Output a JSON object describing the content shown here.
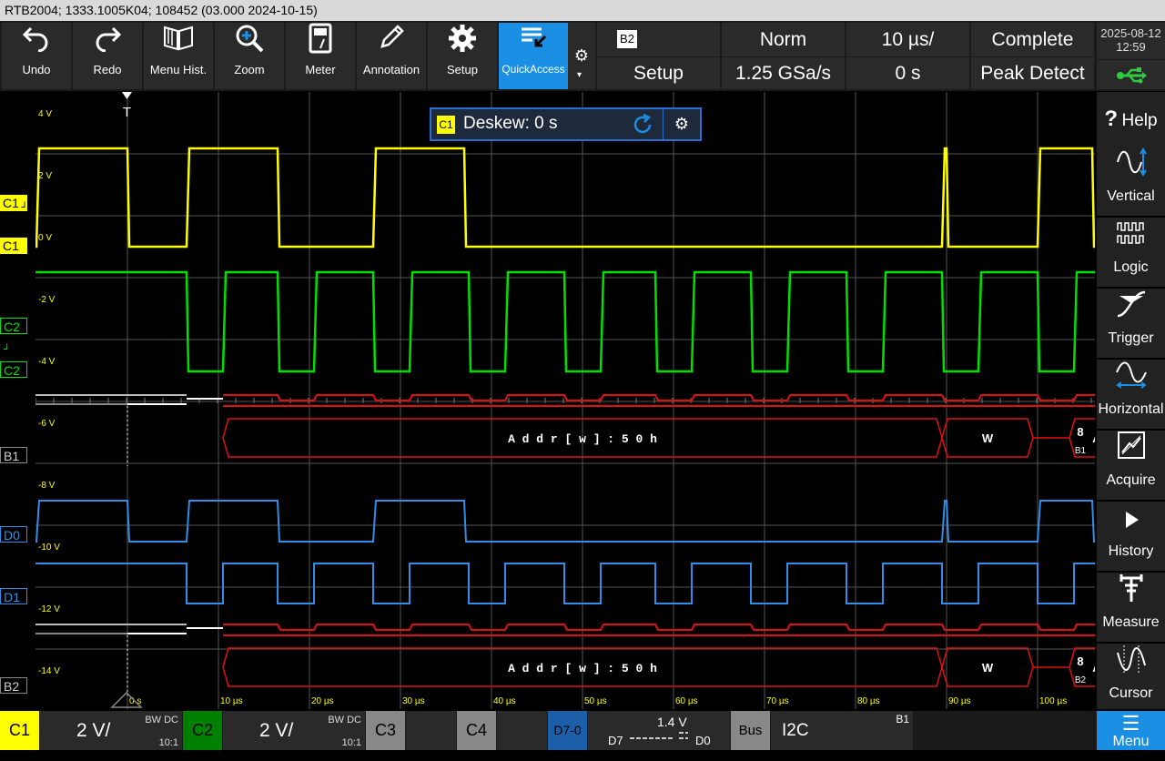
{
  "titlebar": {
    "text": "RTB2004; 1333.1005K04; 108452 (03.000 2024-10-15)"
  },
  "toolbar": {
    "buttons": [
      {
        "label": "Undo",
        "icon": "undo-arrow"
      },
      {
        "label": "Redo",
        "icon": "redo-arrow"
      },
      {
        "label": "Menu Hist.",
        "icon": "book"
      },
      {
        "label": "Zoom",
        "icon": "magnifier-plus"
      },
      {
        "label": "Meter",
        "icon": "meter"
      },
      {
        "label": "Annotation",
        "icon": "pencil"
      },
      {
        "label": "Setup",
        "icon": "gear"
      },
      {
        "label": "QuickAccess",
        "icon": "quickaccess"
      }
    ],
    "status": {
      "bus_badge": "B2",
      "setup_label": "Setup",
      "trigger_mode": "Norm",
      "sample_rate": "1.25 GSa/s",
      "timebase": "10 µs/",
      "position": "0 s",
      "acq_status": "Complete",
      "acq_mode": "Peak Detect"
    },
    "date": "2025-08-12",
    "time": "12:59"
  },
  "sidebar": [
    {
      "label": "Help",
      "icon": "question-icon"
    },
    {
      "label": "Vertical",
      "icon": "vertical-icon"
    },
    {
      "label": "Logic",
      "icon": "logic-icon"
    },
    {
      "label": "Trigger",
      "icon": "trigger-icon"
    },
    {
      "label": "Horizontal",
      "icon": "horizontal-icon"
    },
    {
      "label": "Acquire",
      "icon": "acquire-icon"
    },
    {
      "label": "History",
      "icon": "play-icon"
    },
    {
      "label": "Measure",
      "icon": "measure-icon"
    },
    {
      "label": "Cursor",
      "icon": "cursor-icon"
    }
  ],
  "deskew": {
    "channel": "C1",
    "text": "Deskew: 0 s"
  },
  "y_axis_labels": [
    "4 V",
    "2 V",
    "0 V",
    "-2 V",
    "-4 V",
    "-6 V",
    "-8 V",
    "-10 V",
    "-12 V",
    "-14 V"
  ],
  "x_axis_labels": [
    "0 s",
    "10 µs",
    "20 µs",
    "30 µs",
    "40 µs",
    "50 µs",
    "60 µs",
    "70 µs",
    "80 µs",
    "90 µs",
    "100 µs"
  ],
  "channel_labels": {
    "c1_trig": "C1",
    "c1": "C1",
    "c2_trig": "C2",
    "c2": "C2",
    "b1": "B1",
    "d0": "D0",
    "d1": "D1",
    "b2": "B2"
  },
  "trigger_marker": "T",
  "bus_decodes": {
    "b1": {
      "addr": "A d d r [ w ] : 5 0 h",
      "rw": "W",
      "ack": "A",
      "next": "8",
      "tag": "B1"
    },
    "b2": {
      "addr": "A d d r [ w ] : 5 0 h",
      "rw": "W",
      "ack": "A",
      "next": "8",
      "tag": "B2"
    }
  },
  "bottom": {
    "c1": {
      "label": "C1",
      "scale": "2 V/",
      "bw": "BW DC",
      "probe": "10:1"
    },
    "c2": {
      "label": "C2",
      "scale": "2 V/",
      "bw": "BW DC",
      "probe": "10:1"
    },
    "c3": {
      "label": "C3"
    },
    "c4": {
      "label": "C4"
    },
    "digital": {
      "label": "D7-0",
      "threshold": "1.4 V",
      "d7": "D7",
      "d0": "D0"
    },
    "bus": {
      "label": "Bus",
      "protocol": "I2C",
      "tag": "B1"
    },
    "menu": {
      "label": "Menu"
    }
  },
  "colors": {
    "c1": "#ffff00",
    "c2": "#00e000",
    "digital": "#2f8fe6",
    "bus_bits": "#e01010",
    "grid": "#555555",
    "accent": "#1a8fe3"
  },
  "waveforms": {
    "period_us": 10,
    "c1_high_intervals_us": [
      [
        -10,
        0
      ],
      [
        6.5,
        16.5
      ],
      [
        27,
        37
      ],
      [
        89.5,
        90
      ],
      [
        100,
        106
      ]
    ],
    "c2_low_intervals_us": [
      [
        6.5,
        10.5
      ],
      [
        16.5,
        20.5
      ],
      [
        27,
        31
      ],
      [
        37.5,
        41.5
      ],
      [
        48,
        52
      ],
      [
        58,
        62
      ],
      [
        68.5,
        72.5
      ],
      [
        79,
        83
      ],
      [
        89.5,
        93.5
      ],
      [
        100,
        104
      ]
    ]
  }
}
